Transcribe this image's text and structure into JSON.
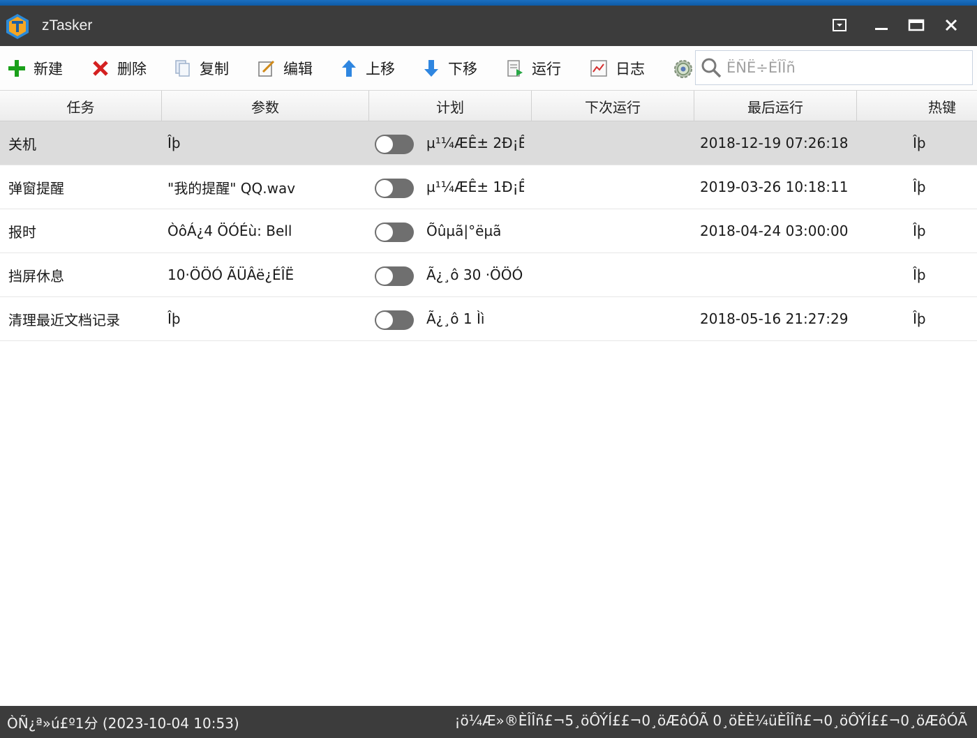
{
  "window": {
    "title": "zTasker"
  },
  "toolbar": {
    "new_label": "新建",
    "delete_label": "删除",
    "copy_label": "复制",
    "edit_label": "编辑",
    "move_up_label": "上移",
    "move_down_label": "下移",
    "run_label": "运行",
    "log_label": "日志"
  },
  "search": {
    "placeholder": "ËÑË÷ÈÎÎñ"
  },
  "table": {
    "columns": [
      "任务",
      "参数",
      "计划",
      "下次运行",
      "最后运行",
      "热键"
    ],
    "rows": [
      {
        "task": "关机",
        "params": "Îþ",
        "enabled": false,
        "plan": "µ¹¼ÆÊ± 2Ð¡Ê",
        "next_run": "",
        "last_run": "2018-12-19 07:26:18",
        "hotkey": "Îþ",
        "selected": true
      },
      {
        "task": "弹窗提醒",
        "params": "\"我的提醒\" QQ.wav",
        "enabled": false,
        "plan": "µ¹¼ÆÊ± 1Ð¡Ê",
        "next_run": "",
        "last_run": "2019-03-26 10:18:11",
        "hotkey": "Îþ",
        "selected": false
      },
      {
        "task": "报时",
        "params": "ÒôÁ¿4 ÖÓÉù: Bell",
        "enabled": false,
        "plan": "Õûµã|°ëµã",
        "next_run": "",
        "last_run": "2018-04-24 03:00:00",
        "hotkey": "Îþ",
        "selected": false
      },
      {
        "task": "挡屏休息",
        "params": "10·ÖÖÓ ÃÜÂë¿ÉÎË",
        "enabled": false,
        "plan": "Ã¿¸ô 30 ·ÖÖÓ",
        "next_run": "",
        "last_run": "",
        "hotkey": "Îþ",
        "selected": false
      },
      {
        "task": "清理最近文档记录",
        "params": "Îþ",
        "enabled": false,
        "plan": "Ã¿¸ô 1 Ìì",
        "next_run": "",
        "last_run": "2018-05-16 21:27:29",
        "hotkey": "Îþ",
        "selected": false
      }
    ]
  },
  "status": {
    "left": "ÒÑ¿ª»ú£º1分 (2023-10-04 10:53)",
    "right": "¡ö¼Æ»®ÈÎÎñ£¬5¸öÔÝÍ££¬0¸öÆôÓÃ   0¸öÈÈ¼üÈÎÎñ£¬0¸öÔÝÍ££¬0¸öÆôÓÃ"
  },
  "colors": {
    "titlebar": "#3c3c3c",
    "accent_blue": "#1a6fc0",
    "selected_row": "#dcdcdc"
  }
}
